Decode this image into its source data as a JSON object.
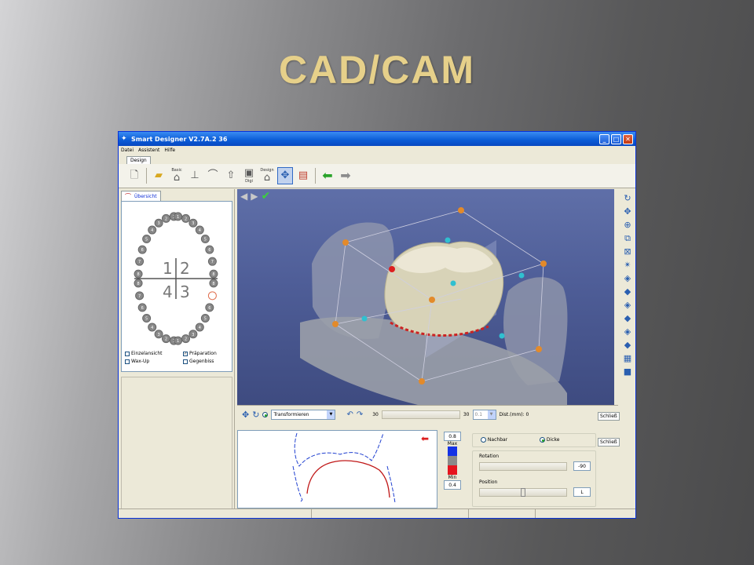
{
  "slide": {
    "title": "CAD/CAM"
  },
  "window": {
    "title": "Smart Designer V2.7A.2   36",
    "menu": [
      "Datei",
      "Assistent",
      "Hilfe"
    ],
    "tab": "Design",
    "toolbar": {
      "basic_label": "Basic",
      "digi_label": "Digi",
      "design_label": "Design"
    }
  },
  "left_panel": {
    "tab_label": "Übersicht",
    "quadrants": {
      "q1": "1",
      "q2": "2",
      "q3": "3",
      "q4": "4"
    },
    "checkboxes": [
      {
        "label": "Einzelansicht",
        "checked": false
      },
      {
        "label": "Präparation",
        "checked": true
      },
      {
        "label": "Wax-Up",
        "checked": false
      },
      {
        "label": "Gegenbiss",
        "checked": false
      }
    ]
  },
  "controls": {
    "mode_select": "Transformieren",
    "slider_min": "30",
    "slider_max": "30",
    "step_value": "0.1",
    "dist_label": "Dist.(mm): 0",
    "side_tab_1": "Schließ",
    "side_tab_2": "Schließ"
  },
  "scale": {
    "max_value": "0.8",
    "max_label": "Max",
    "min_label": "Min",
    "min_value": "0.4",
    "colors": [
      "#1432e6",
      "#8a8a8a",
      "#e6141e"
    ]
  },
  "props": {
    "radio_nachbar": "Nachbar",
    "radio_dicke": "Dicke",
    "rotation_label": "Rotation",
    "rotation_value": "-90",
    "position_label": "Position",
    "position_value": "L"
  }
}
